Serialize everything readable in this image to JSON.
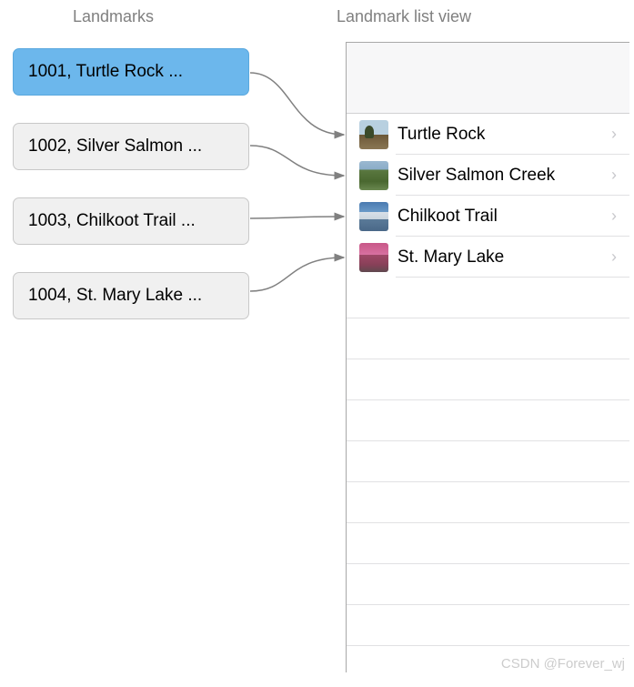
{
  "headings": {
    "left": "Landmarks",
    "right": "Landmark list view"
  },
  "landmarks": [
    {
      "id": "1001",
      "label": "1001, Turtle Rock ...",
      "selected": true
    },
    {
      "id": "1002",
      "label": "1002, Silver Salmon ...",
      "selected": false
    },
    {
      "id": "1003",
      "label": "1003, Chilkoot Trail ...",
      "selected": false
    },
    {
      "id": "1004",
      "label": "1004, St. Mary Lake ...",
      "selected": false
    }
  ],
  "listRows": [
    {
      "name": "Turtle Rock",
      "thumbClass": "thumb-turtle"
    },
    {
      "name": "Silver Salmon Creek",
      "thumbClass": "thumb-salmon"
    },
    {
      "name": "Chilkoot Trail",
      "thumbClass": "thumb-chilkoot"
    },
    {
      "name": "St. Mary Lake",
      "thumbClass": "thumb-stmary"
    }
  ],
  "chevron": "›",
  "watermark": "CSDN @Forever_wj"
}
